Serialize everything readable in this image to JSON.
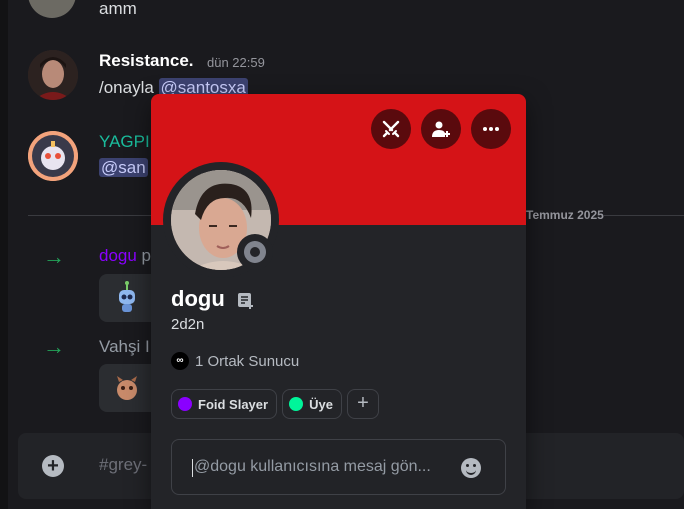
{
  "chat": {
    "messages": [
      {
        "text": "amm"
      },
      {
        "author": "Resistance.",
        "timestamp": "dün 22:59",
        "prefix": "/onayla ",
        "mention": "@santosxa"
      },
      {
        "author": "YAGPI",
        "mention": "@san"
      }
    ],
    "date_divider": "Temmuz 2025",
    "system": [
      {
        "user": "dogu",
        "rest": " p"
      },
      {
        "user": "Vahşi I"
      }
    ],
    "composer_placeholder": "#grey-"
  },
  "profile": {
    "display_name": "dogu",
    "username": "2d2n",
    "mutual_servers": "1 Ortak Sunucu",
    "mutual_icon": "∞",
    "roles": [
      {
        "label": "Foid Slayer",
        "color": "#8a00ff"
      },
      {
        "label": "Üye",
        "color": "#00f59a"
      }
    ],
    "add_role": "+",
    "message_placeholder": "@dogu kullanıcısına mesaj gön...",
    "banner_color": "#d51317",
    "status": "offline"
  },
  "icons": {
    "swords": "swords-icon",
    "add_friend": "add-friend-icon",
    "more": "more-icon",
    "note": "note-icon",
    "emoji": "emoji-icon"
  }
}
